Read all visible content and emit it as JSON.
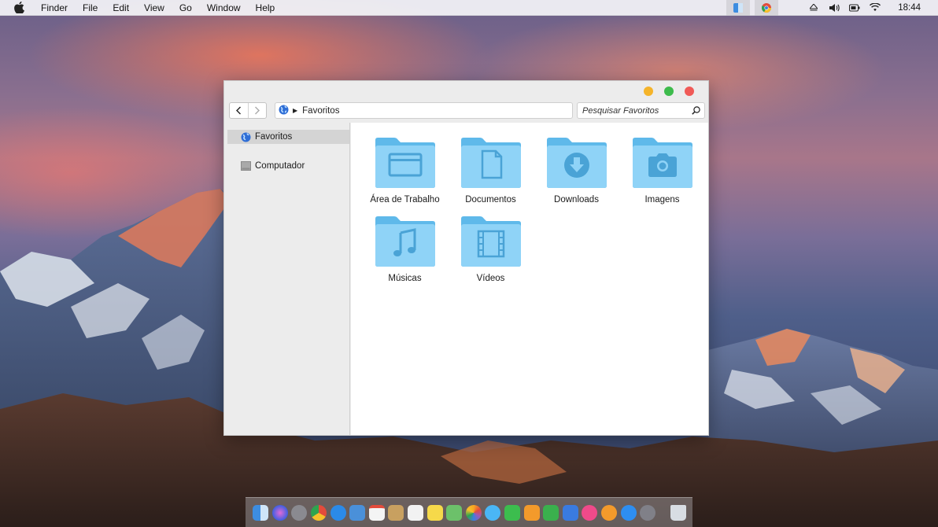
{
  "menubar": {
    "app_name": "Finder",
    "items": [
      "File",
      "Edit",
      "View",
      "Go",
      "Window",
      "Help"
    ],
    "clock": "18:44"
  },
  "window": {
    "path_label": "Favoritos",
    "search_placeholder": "Pesquisar Favoritos",
    "sidebar": [
      {
        "label": "Favoritos",
        "icon": "globe-icon",
        "selected": true
      },
      {
        "label": "Computador",
        "icon": "drive-icon",
        "selected": false
      }
    ],
    "folders": [
      {
        "label": "Área de Trabalho",
        "icon": "desktop-folder-icon"
      },
      {
        "label": "Documentos",
        "icon": "documents-folder-icon"
      },
      {
        "label": "Downloads",
        "icon": "downloads-folder-icon"
      },
      {
        "label": "Imagens",
        "icon": "pictures-folder-icon"
      },
      {
        "label": "Músicas",
        "icon": "music-folder-icon"
      },
      {
        "label": "Vídeos",
        "icon": "movies-folder-icon"
      }
    ]
  },
  "colors": {
    "folder_light": "#8fd3f7",
    "folder_dark": "#5fb9ea",
    "folder_glyph": "#4aa3d6",
    "selection": "#d4d4d4"
  },
  "dock": {
    "items": [
      {
        "icon": "finder-icon",
        "color": "#3d8de0"
      },
      {
        "icon": "siri-icon",
        "color": "#6a6ad8"
      },
      {
        "icon": "launchpad-icon",
        "color": "#8a8a90"
      },
      {
        "icon": "chrome-icon",
        "color": "#e34b3b"
      },
      {
        "icon": "safari-icon",
        "color": "#2b8ae8"
      },
      {
        "icon": "mail-icon",
        "color": "#4a90d9"
      },
      {
        "icon": "calendar-icon",
        "color": "#f4f4f4"
      },
      {
        "icon": "contacts-icon",
        "color": "#c8a060"
      },
      {
        "icon": "reminders-icon",
        "color": "#f2f2f2"
      },
      {
        "icon": "notes-icon",
        "color": "#f6d94a"
      },
      {
        "icon": "maps-icon",
        "color": "#6cc16a"
      },
      {
        "icon": "photos-icon",
        "color": "#f5a623"
      },
      {
        "icon": "messages-icon",
        "color": "#4ab6f5"
      },
      {
        "icon": "facetime-icon",
        "color": "#3cbd4e"
      },
      {
        "icon": "pages-icon",
        "color": "#f39a2b"
      },
      {
        "icon": "numbers-icon",
        "color": "#3ab04d"
      },
      {
        "icon": "keynote-icon",
        "color": "#3a7be0"
      },
      {
        "icon": "itunes-icon",
        "color": "#f04a8a"
      },
      {
        "icon": "ibooks-icon",
        "color": "#f39a2b"
      },
      {
        "icon": "app-store-icon",
        "color": "#2e8ef0"
      },
      {
        "icon": "system-preferences-icon",
        "color": "#808088"
      },
      {
        "icon": "trash-icon",
        "color": "#d8dde3"
      }
    ]
  }
}
